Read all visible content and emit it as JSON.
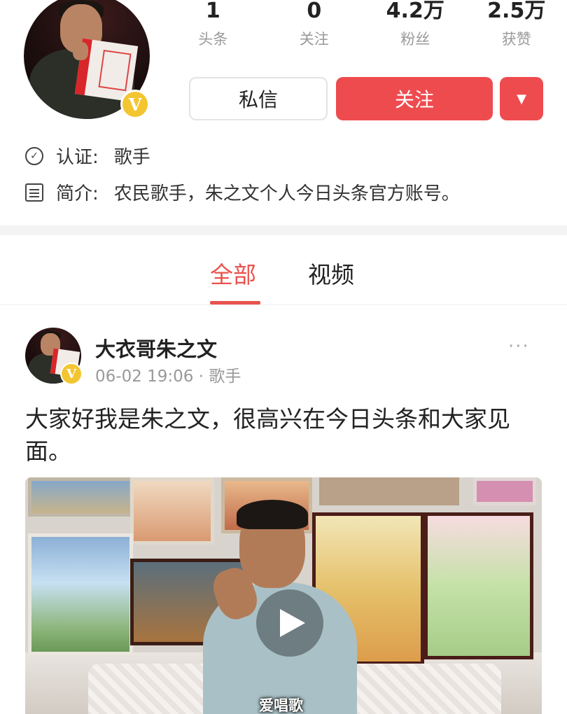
{
  "profile": {
    "verified_badge": "V",
    "stats": [
      {
        "value": "1",
        "label": "头条"
      },
      {
        "value": "0",
        "label": "关注"
      },
      {
        "value": "4.2万",
        "label": "粉丝"
      },
      {
        "value": "2.5万",
        "label": "获赞"
      }
    ],
    "message_button": "私信",
    "follow_button": "关注",
    "more_icon": "caret-down-icon",
    "verification_label": "认证:",
    "verification_value": "歌手",
    "intro_label": "简介:",
    "intro_value": "农民歌手，朱之文个人今日头条官方账号。"
  },
  "tabs": [
    {
      "label": "全部",
      "active": true
    },
    {
      "label": "视频",
      "active": false
    }
  ],
  "post": {
    "author": "大衣哥朱之文",
    "timestamp": "06-02 19:06",
    "meta_sep": " · ",
    "category": "歌手",
    "more": "···",
    "text": "大家好我是朱之文，很高兴在今日头条和大家见面。",
    "video_icon": "play-icon"
  },
  "watermark": "爱唱歌",
  "colors": {
    "accent": "#ee4b4f",
    "tab_active": "#e8524d",
    "verified": "#f3c531",
    "muted": "#999999"
  }
}
